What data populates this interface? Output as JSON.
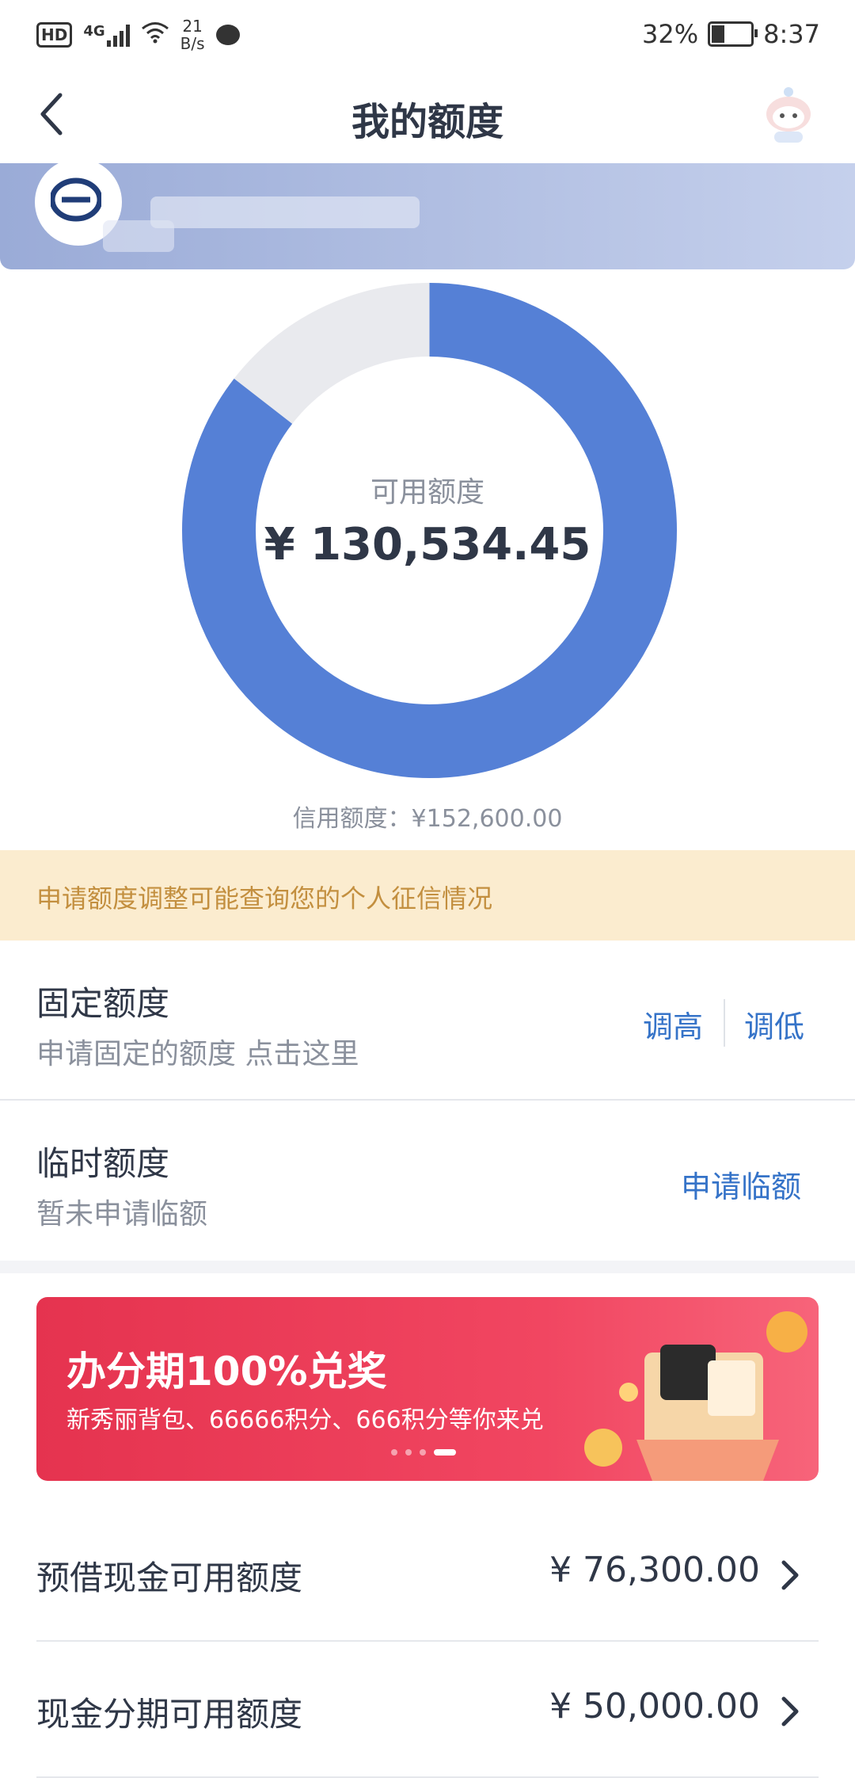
{
  "status_bar": {
    "network_badge": "HD",
    "signal": "4G",
    "speed_value": "21",
    "speed_unit": "B/s",
    "battery": "32%",
    "time": "8:37"
  },
  "header": {
    "title": "我的额度"
  },
  "quota": {
    "available_label": "可用额度",
    "available_value": "¥ 130,534.45",
    "credit_limit_text": "信用额度：¥152,600.00",
    "available_fraction": 0.855
  },
  "notice": {
    "text": "申请额度调整可能查询您的个人征信情况"
  },
  "fixed_quota": {
    "title": "固定额度",
    "subtitle": "申请固定的额度 点击这里",
    "increase_label": "调高",
    "decrease_label": "调低"
  },
  "temp_quota": {
    "title": "临时额度",
    "subtitle": "暂未申请临额",
    "apply_label": "申请临额"
  },
  "banner": {
    "title": "办分期100%兑奖",
    "subtitle": "新秀丽背包、66666积分、666积分等你来兑",
    "slide_count": 4,
    "active_slide": 4
  },
  "list": [
    {
      "label": "预借现金可用额度",
      "value": "¥ 76,300.00"
    },
    {
      "label": "现金分期可用额度",
      "value": "¥ 50,000.00"
    }
  ],
  "colors": {
    "donut_used": "#e9eaee",
    "donut_available": "#5580d6",
    "link": "#3573c8",
    "notice_bg": "#fbeccf",
    "notice_text": "#c38f3f"
  }
}
